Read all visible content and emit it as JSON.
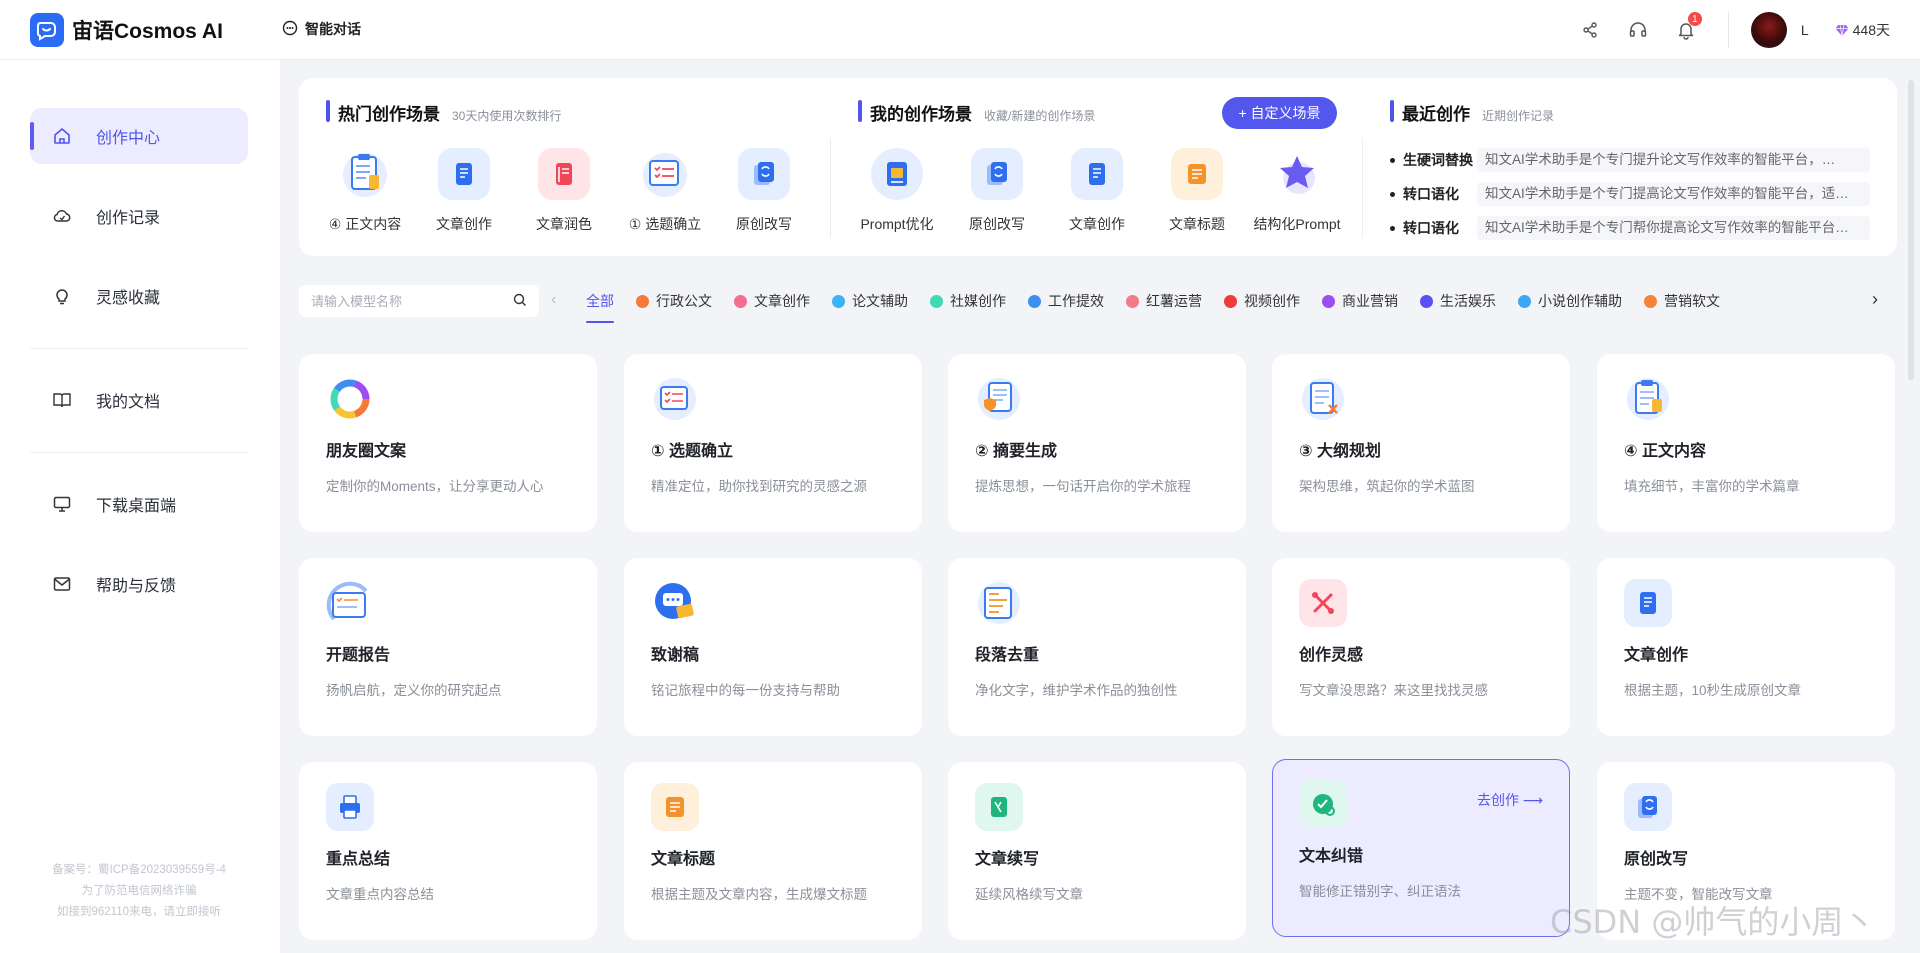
{
  "header": {
    "logo_text": "宙语Cosmos AI",
    "tab_label": "智能对话",
    "notification_count": "1",
    "user_name": "L",
    "vip_days": "448天"
  },
  "sidebar": {
    "items": [
      {
        "label": "创作中心",
        "icon": "home-icon"
      },
      {
        "label": "创作记录",
        "icon": "cloud-icon"
      },
      {
        "label": "灵感收藏",
        "icon": "lightbulb-icon"
      },
      {
        "label": "我的文档",
        "icon": "book-icon"
      },
      {
        "label": "下载桌面端",
        "icon": "monitor-icon"
      },
      {
        "label": "帮助与反馈",
        "icon": "mail-icon"
      }
    ],
    "footer": [
      "备案号：蜀ICP备2023039559号-4",
      "为了防范电信网络诈骗",
      "如接到962110来电，请立即接听"
    ]
  },
  "hot": {
    "title": "热门创作场景",
    "subtitle": "30天内使用次数排行",
    "items": [
      "④ 正文内容",
      "文章创作",
      "文章润色",
      "① 选题确立",
      "原创改写"
    ]
  },
  "mine": {
    "title": "我的创作场景",
    "subtitle": "收藏/新建的创作场景",
    "custom_button": "+ 自定义场景",
    "items": [
      "Prompt优化",
      "原创改写",
      "文章创作",
      "文章标题",
      "结构化Prompt"
    ]
  },
  "recent": {
    "title": "最近创作",
    "subtitle": "近期创作记录",
    "rows": [
      {
        "key": "生硬词替换",
        "value": "知文AI学术助手是个专门提升论文写作效率的智能平台，…"
      },
      {
        "key": "转口语化",
        "value": "知文AI学术助手是个专门提高论文写作效率的智能平台，适…"
      },
      {
        "key": "转口语化",
        "value": "知文AI学术助手是个专门帮你提高论文写作效率的智能平台…"
      }
    ]
  },
  "search": {
    "placeholder": "请输入模型名称"
  },
  "categories": [
    {
      "label": "全部",
      "color": ""
    },
    {
      "label": "行政公文",
      "color": "#f5793b"
    },
    {
      "label": "文章创作",
      "color": "#f36f8f"
    },
    {
      "label": "论文辅助",
      "color": "#3ab4f2"
    },
    {
      "label": "社媒创作",
      "color": "#3fd9b5"
    },
    {
      "label": "工作提效",
      "color": "#3d8ef0"
    },
    {
      "label": "红薯运营",
      "color": "#f27a8a"
    },
    {
      "label": "视频创作",
      "color": "#ef3b3b"
    },
    {
      "label": "商业营销",
      "color": "#9b4ff0"
    },
    {
      "label": "生活娱乐",
      "color": "#5a4ff0"
    },
    {
      "label": "小说创作辅助",
      "color": "#3aa8f5"
    },
    {
      "label": "营销软文",
      "color": "#f5833b"
    }
  ],
  "cards": [
    {
      "title": "朋友圈文案",
      "desc": "定制你的Moments，让分享更动人心",
      "icon": "rainbow-ring-icon"
    },
    {
      "title": "① 选题确立",
      "desc": "精准定位，助你找到研究的灵感之源",
      "icon": "checklist-icon"
    },
    {
      "title": "② 摘要生成",
      "desc": "提炼思想，一句话开启你的学术旅程",
      "icon": "shield-doc-icon"
    },
    {
      "title": "③ 大纲规划",
      "desc": "架构思维，筑起你的学术蓝图",
      "icon": "outline-doc-icon"
    },
    {
      "title": "④ 正文内容",
      "desc": "填充细节，丰富你的学术篇章",
      "icon": "clipboard-icon"
    },
    {
      "title": "开题报告",
      "desc": "扬帆启航，定义你的研究起点",
      "icon": "report-icon"
    },
    {
      "title": "致谢稿",
      "desc": "铭记旅程中的每一份支持与帮助",
      "icon": "chat-icon"
    },
    {
      "title": "段落去重",
      "desc": "净化文字，维护学术作品的独创性",
      "icon": "paragraph-icon"
    },
    {
      "title": "创作灵感",
      "desc": "写文章没思路？来这里找找灵感",
      "icon": "tools-icon"
    },
    {
      "title": "文章创作",
      "desc": "根据主题，10秒生成原创文章",
      "icon": "doc-icon"
    },
    {
      "title": "重点总结",
      "desc": "文章重点内容总结",
      "icon": "printer-icon"
    },
    {
      "title": "文章标题",
      "desc": "根据主题及文章内容，生成爆文标题",
      "icon": "title-icon"
    },
    {
      "title": "文章续写",
      "desc": "延续风格续写文章",
      "icon": "continue-icon"
    },
    {
      "title": "文本纠错",
      "desc": "智能修正错别字、纠正语法",
      "icon": "check-circle-icon",
      "action": "去创作 ⟶"
    },
    {
      "title": "原创改写",
      "desc": "主题不变，智能改写文章",
      "icon": "rewrite-icon"
    }
  ],
  "watermark": "CSDN @帅气的小周丶"
}
